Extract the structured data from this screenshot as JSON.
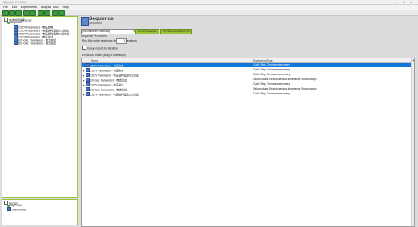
{
  "window": {
    "title": "MainWin 7.0.0010",
    "controls": {
      "minimize": "–",
      "maximize": "□",
      "close": "×"
    }
  },
  "menu": [
    "File",
    "Edit",
    "Experiments",
    "Analysis Tools",
    "Help"
  ],
  "toolbar": {
    "icon_names": [
      "new-icon",
      "open-icon",
      "save-icon",
      "copy-icon",
      "paste-icon",
      "run-icon",
      "stop-icon",
      "settings-icon",
      "chart-icon"
    ]
  },
  "tree": {
    "root": "电池测试结果2.pstx",
    "sequence": "Sequence",
    "items": [
      "CSCV Parameters - 电压充电",
      "CSCV Parameters - 电压结构追踪DC(测试)",
      "CSCV Parameters - 电压结构追踪DC(测试)",
      "CSCV Parameters - 电压测试",
      "EIS-GAL Parameters - 电流测试",
      "EIS-GAL Parameters - 电流测试"
    ]
  },
  "devices": {
    "root": "Devices",
    "items": [
      "My Profile",
      "Instruments"
    ]
  },
  "main": {
    "title": "Sequence",
    "subtitle": "Sequence",
    "instrument_select": "(no instrument selected)",
    "tabs": [
      "Run All Sequence",
      "Run Selected Experiment"
    ],
    "props_label": "Sequence Properties",
    "run_label": "Run this entire sequence for",
    "run_count": "1",
    "run_suffix": "iterations",
    "group_label": "Group results by iteration",
    "exec_label": "Execution order: (drag to rearrange)"
  },
  "grid": {
    "columns": [
      "Name",
      "Experiment Type"
    ],
    "rows": [
      {
        "name": "CSCV Parameters - 电压充电",
        "type": "Cyclic Step Chronoamperometry"
      },
      {
        "name": "CSCV Parameters - 电压充电",
        "type": "Cyclic Step Chronoamperometry"
      },
      {
        "name": "CSCV Parameters - 电压结构追踪DC(测试)",
        "type": "Cyclic Step Chronoamperometry"
      },
      {
        "name": "EIS-GAL Parameters - 电流测试",
        "type": "Galvanostatic Electrochemical Impedance Spectroscopy"
      },
      {
        "name": "CSCV Parameters - 电压测试",
        "type": "Cyclic Step Chronoamperometry"
      },
      {
        "name": "EIS-GAL Parameters - 电流测试",
        "type": "Galvanostatic Electrochemical Impedance Spectroscopy"
      },
      {
        "name": "CSCV Parameters - 电压结构追踪DC(测试)",
        "type": "Cyclic Step Chronoamperometry"
      }
    ]
  },
  "colors": {
    "accent": "#9bc43b",
    "selection": "#0d78d7"
  }
}
